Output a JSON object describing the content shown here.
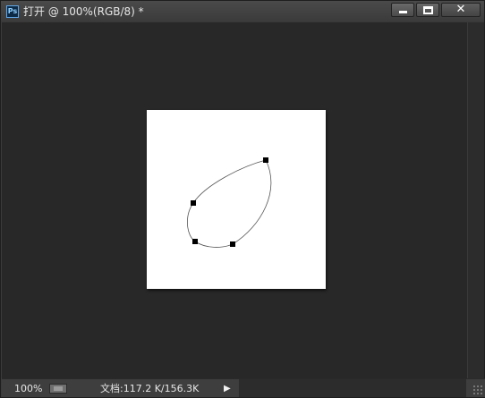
{
  "window": {
    "title": "打开 @ 100%(RGB/8) *",
    "app_icon": "Ps",
    "controls": {
      "minimize": "minimize-icon",
      "maximize": "maximize-icon",
      "close": "close-icon",
      "close_glyph": "✕"
    }
  },
  "canvas": {
    "background": "#ffffff",
    "path": {
      "stroke": "#555555",
      "anchor_color": "#000000"
    }
  },
  "status": {
    "zoom": "100%",
    "doc_info": "文档:117.2 K/156.3K",
    "arrow": "▶"
  },
  "colors": {
    "workspace": "#282828",
    "chrome": "#3c3c3c"
  }
}
